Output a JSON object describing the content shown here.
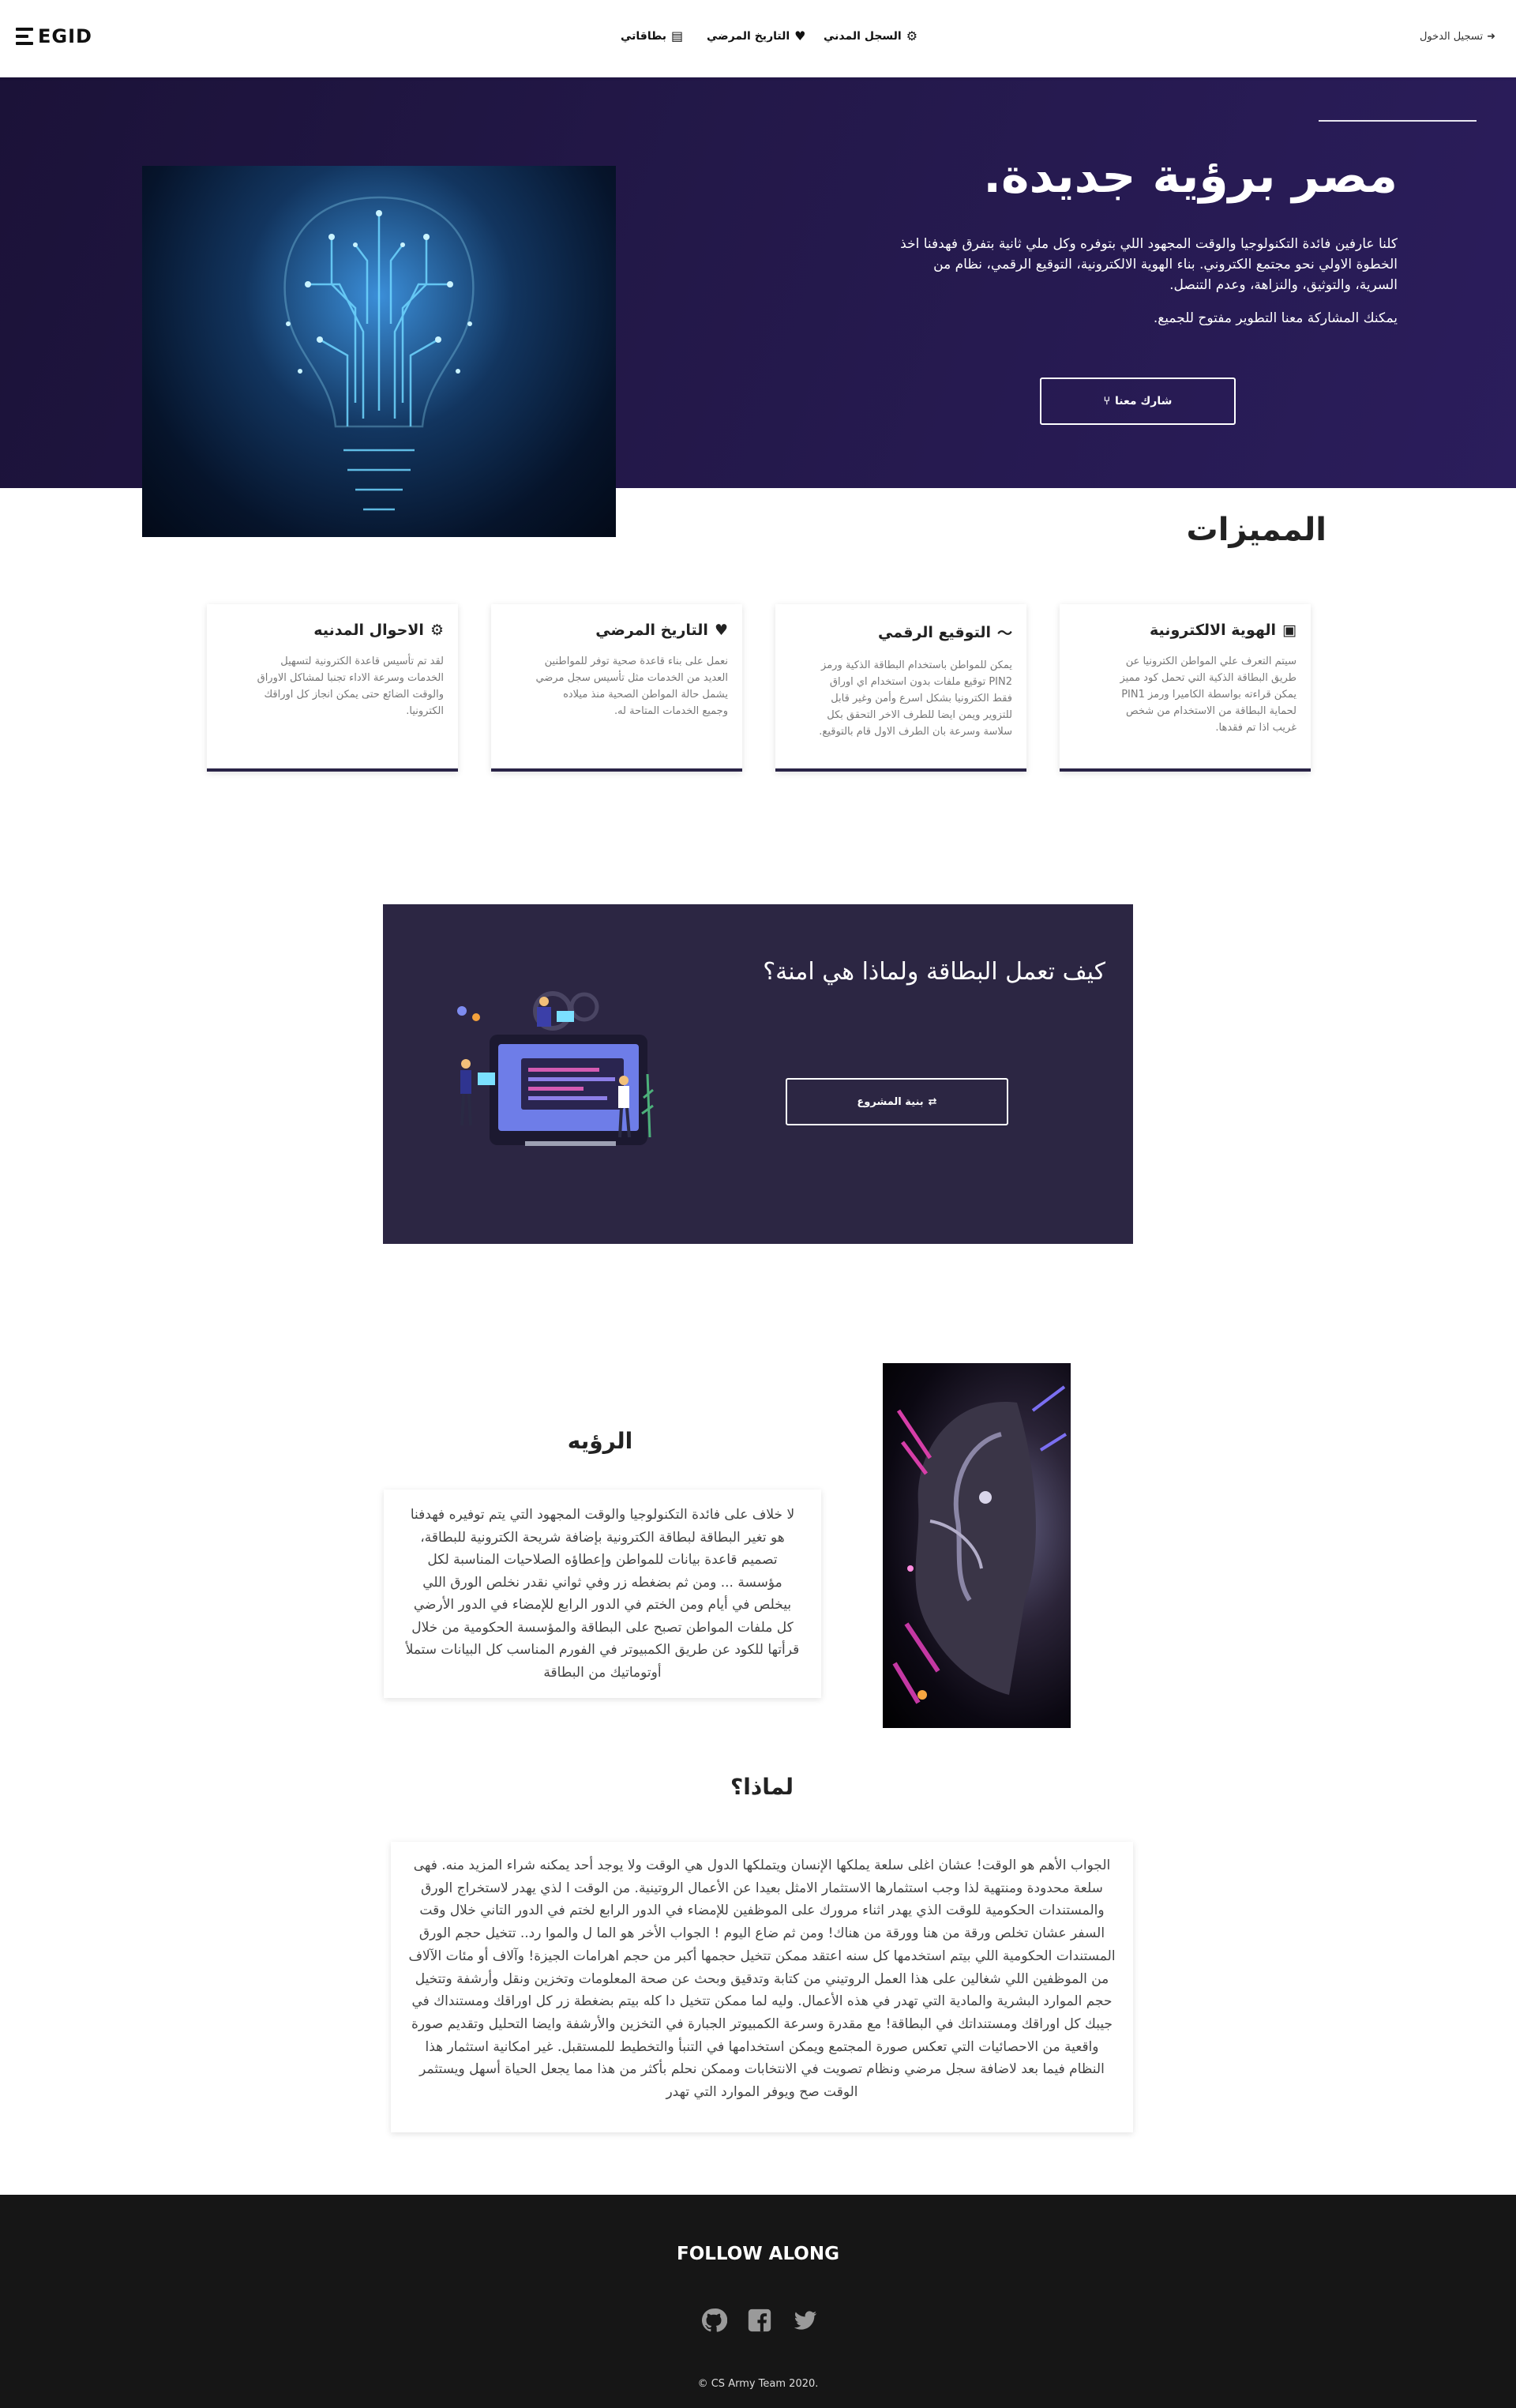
{
  "brand": {
    "logo_text": "EGID"
  },
  "nav": {
    "civil_registry": "السجل المدني",
    "medical_history": "التاريخ المرضي",
    "my_cards": "بطاقاتي",
    "login": "تسجيل الدخول"
  },
  "hero": {
    "title": "مصر برؤية جديدة.",
    "text": "كلنا عارفين فائدة التكنولوجيا والوقت المجهود اللي بتوفره وكل ملي ثانية بتفرق فهدفنا اخذ الخطوة الاولي نحو مجتمع الكتروني. بناء الهوية الالكترونية، التوقيع الرقمي، نظام من السرية، والتوثيق، والنزاهة، وعدم التنصل.",
    "sub": "يمكنك المشاركة معنا التطوير مفتوح للجميع.",
    "button": "شارك معنا"
  },
  "features": {
    "title": "المميزات",
    "cards": [
      {
        "title": "الهوية الالكترونية",
        "icon": "id-card-icon",
        "text": "سيتم التعرف علي المواطن الكترونيا عن طريق البطاقة الذكية التي تحمل كود مميز يمكن قراءته بواسطة الكاميرا ورمز PIN1 لحماية البطاقة من الاستخدام من شخص غريب اذا تم فقدها."
      },
      {
        "title": "التوقيع الرقمي",
        "icon": "signature-icon",
        "text": "يمكن للمواطن باستخدام البطاقة الذكية ورمز PIN2 توقيع ملفات بدون استخدام اي اوراق فقط الكترونيا بشكل اسرع وأمن وغير قابل للتزوير ويمن ايضا للطرف الاخر التحقق بكل سلاسة وسرعة بان الطرف الاول قام بالتوقيع."
      },
      {
        "title": "التاريخ المرضي",
        "icon": "heartbeat-icon",
        "text": "نعمل على بناء قاعدة صحية توفر للمواطنين العديد من الخدمات مثل تأسيس سجل مرضي يشمل حالة المواطن الصحية منذ ميلاده وجميع الخدمات المتاحة له."
      },
      {
        "title": "الاحوال المدنيه",
        "icon": "cogs-icon",
        "text": "لقد تم تأسيس قاعدة الكترونية لتسهيل الخدمات وسرعة الاداء تجنبا لمشاكل الاوراق والوقت الضائع حتى يمكن انجاز كل اوراقك الكترونيا."
      }
    ]
  },
  "how": {
    "title": "كيف تعمل البطاقة ولماذا هي امنة؟",
    "button": "بنية المشروع"
  },
  "vision": {
    "title": "الرؤيه",
    "text": "لا خلاف على فائدة التكنولوجيا والوقت المجهود التي يتم توفيره فهدفنا هو تغير البطاقة لبطاقة الكترونية بإضافة شريحة الكترونية للبطاقة، تصميم قاعدة بيانات للمواطن وإعطاؤه الصلاحيات المناسبة لكل مؤسسة ... ومن ثم بضغطه زر وفي ثواني نقدر نخلص الورق اللي بيخلص في أيام ومن الختم في الدور الرابع للإمضاء في الدور الأرضي كل ملفات المواطن تصبح على البطاقة والمؤسسة الحكومية من خلال قرأتها للكود عن طريق الكمبيوتر في الفورم المناسب كل البيانات ستملأ أوتوماتيك من البطاقة"
  },
  "why": {
    "title": "لماذا؟",
    "text": "الجواب الأهم هو الوقت! عشان اغلى سلعة يملكها الإنسان ويتملكها الدول هي الوقت ولا يوجد أحد يمكنه شراء المزيد منه. فهى سلعة محدودة ومنتهية لذا وجب استثمارها الاستثمار الامثل بعيدا عن الأعمال الروتينية. من الوقت ا لذي يهدر لاستخراج الورق والمستندات الحكومية للوقت الذي يهدر اثناء مرورك على الموظفين للإمضاء في الدور الرابع لختم في الدور التاني خلال وقت السفر عشان تخلص ورقة من هنا وورقة من هناك! ومن ثم ضاع اليوم ! الجواب الأخر هو الما ل والموا رد.. تتخيل حجم الورق المستندات الحكومية اللي بيتم استخدمها كل سنه اعتقد ممكن تتخيل حجمها أكبر من حجم اهرامات الجيزة! وآلاف أو مئات الآلاف من الموظفين اللي شغالين على هذا العمل الروتيني من كتابة وتدقيق وبحث عن صحة المعلومات وتخزين ونقل وأرشفة وتتخيل حجم الموارد البشرية والمادية التي تهدر في هذه الأعمال. وليه لما ممكن تتخيل دا كله بيتم بضغطة زر كل اوراقك ومستنداك في جيبك كل اوراقك ومستنداتك في البطاقة! مع مقدرة وسرعة الكمبيوتر الجبارة في التخزين والأرشفة وايضا التحليل وتقديم صورة واقعية من الاحصائيات التي تعكس صورة المجتمع ويمكن استخدامها في التنبأ والتخطيط للمستقبل. غير امكانية استثمار هذا النظام فيما بعد لاضافة سجل مرضي ونظام تصويت في الانتخابات وممكن نحلم بأكثر من هذا مما يجعل الحياة أسهل ويستثمر الوقت صح ويوفر الموارد التي تهدر"
  },
  "footer": {
    "follow": "FOLLOW ALONG",
    "socials": [
      "github-icon",
      "facebook-icon",
      "twitter-icon"
    ],
    "copyright": "© CS Army Team 2020."
  },
  "colors": {
    "hero_bg": "#231849",
    "how_bg": "#2c2643",
    "footer_bg": "#161616",
    "accent": "#2a2447"
  }
}
